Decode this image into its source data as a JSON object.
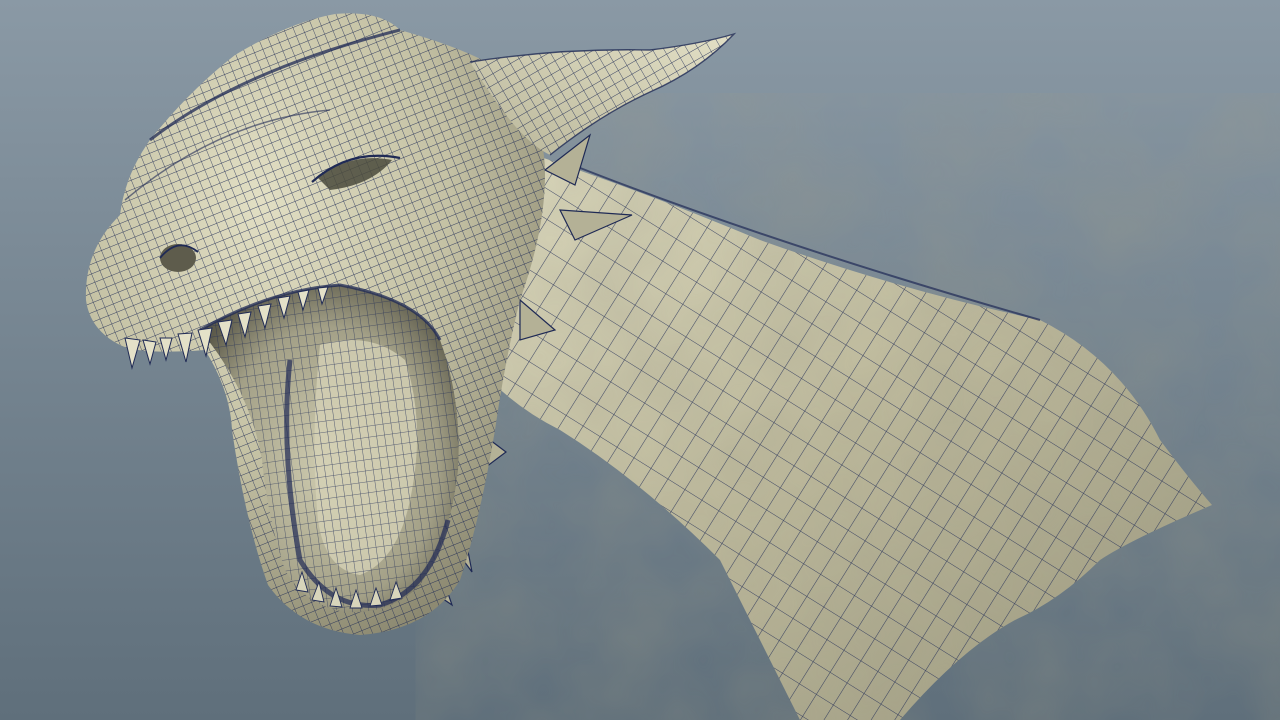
{
  "viewport": {
    "background_top": "#8a99a5",
    "background_bottom": "#5f6f7b"
  },
  "model": {
    "subject": "dragon-head-sculpt",
    "display_mode": "wireframe-on-shaded",
    "surface_color": "#c8c5a8",
    "surface_shadow_color": "#8f8c74",
    "wire_color": "#1f2a55",
    "mouth_inner_color": "#a6a28a"
  }
}
